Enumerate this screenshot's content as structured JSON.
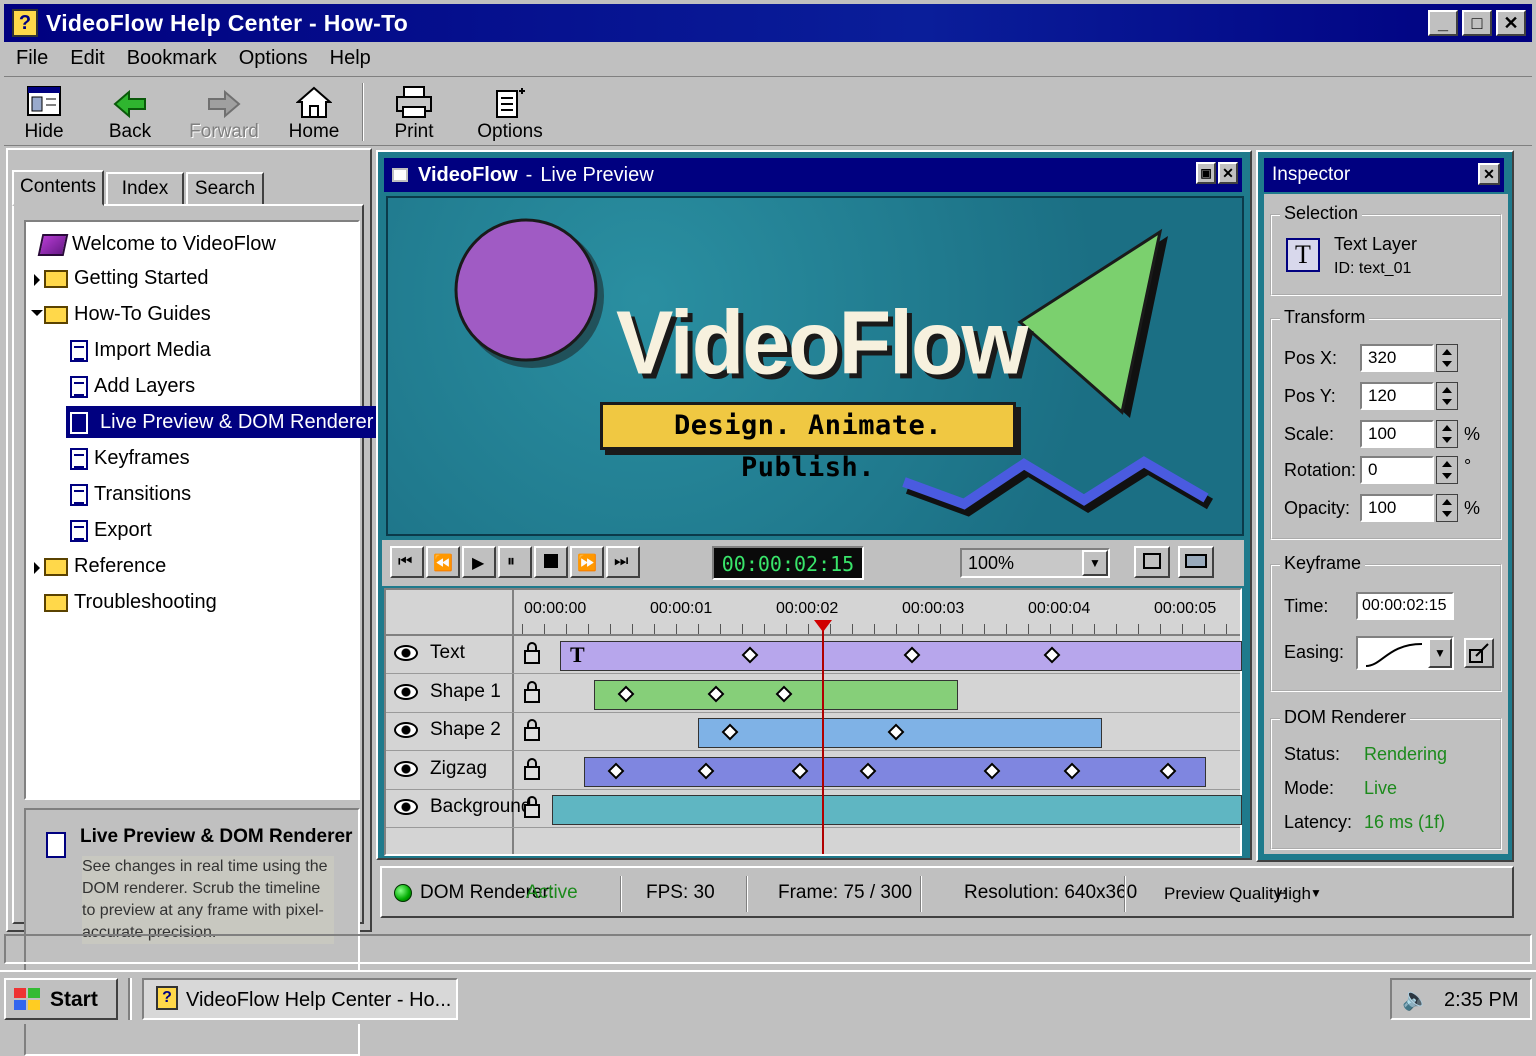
{
  "window": {
    "title": "VideoFlow Help Center - How-To"
  },
  "menu": [
    {
      "label": "File"
    },
    {
      "label": "Edit"
    },
    {
      "label": "Bookmark"
    },
    {
      "label": "Options"
    },
    {
      "label": "Help"
    }
  ],
  "toolbar": {
    "hide": "Hide",
    "back": "Back",
    "forward": "Forward",
    "home": "Home",
    "print": "Print",
    "options": "Options"
  },
  "tabs": {
    "contents": "Contents",
    "index": "Index",
    "search": "Search"
  },
  "tree": [
    {
      "label": "Welcome to VideoFlow",
      "type": "book"
    },
    {
      "label": "Getting Started",
      "type": "folder"
    },
    {
      "label": "How-To Guides",
      "type": "folder-open"
    },
    {
      "label": "Import Media",
      "type": "doc"
    },
    {
      "label": "Add Layers",
      "type": "doc"
    },
    {
      "label": "Live Preview & DOM Renderer",
      "type": "doc",
      "selected": true
    },
    {
      "label": "Keyframes",
      "type": "doc"
    },
    {
      "label": "Transitions",
      "type": "doc"
    },
    {
      "label": "Export",
      "type": "doc"
    },
    {
      "label": "Reference",
      "type": "folder"
    },
    {
      "label": "Troubleshooting",
      "type": "folder"
    }
  ],
  "topic": {
    "title": "Live Preview & DOM Renderer",
    "body": "See changes in real time using the DOM renderer. Scrub the timeline to preview at any frame with pixel-accurate precision."
  },
  "preview": {
    "title_app": "VideoFlow",
    "title_sep": "-",
    "title_view": "Live Preview",
    "stage_logo": "VideoFlow",
    "stage_tagline": "Design. Animate. Publish.",
    "timecode": "00:00:02:15",
    "zoom": "100%"
  },
  "timeline": {
    "ruler": [
      "00:00:00",
      "00:00:01",
      "00:00:02",
      "00:00:03",
      "00:00:04",
      "00:00:05"
    ],
    "playhead_seconds": 2.5,
    "tracks": [
      {
        "name": "Text",
        "color": "#b7a6ec"
      },
      {
        "name": "Shape 1",
        "color": "#86cf79"
      },
      {
        "name": "Shape 2",
        "color": "#7fb2e6"
      },
      {
        "name": "Zigzag",
        "color": "#7f86e0"
      },
      {
        "name": "Background",
        "color": "#5fb6c2"
      }
    ]
  },
  "inspector": {
    "title": "Inspector",
    "selection_group": "Selection",
    "layer_type": "Text Layer",
    "layer_id": "ID:  text_01",
    "transform_group": "Transform",
    "pos_x_label": "Pos X:",
    "pos_x": "320",
    "pos_y_label": "Pos Y:",
    "pos_y": "120",
    "scale_label": "Scale:",
    "scale": "100",
    "scale_unit": "%",
    "rotation_label": "Rotation:",
    "rotation": "0",
    "rotation_unit": "°",
    "opacity_label": "Opacity:",
    "opacity": "100",
    "opacity_unit": "%",
    "keyframe_group": "Keyframe",
    "time_label": "Time:",
    "time": "00:00:02:15",
    "easing_label": "Easing:",
    "dom_group": "DOM Renderer",
    "status_label": "Status:",
    "status": "Rendering",
    "mode_label": "Mode:",
    "mode": "Live",
    "latency_label": "Latency:",
    "latency": "16 ms (1f)"
  },
  "statusbar": {
    "dom_label": "DOM Renderer:",
    "dom_value": "Active",
    "fps": "FPS: 30",
    "frame": "Frame: 75 / 300",
    "resolution": "Resolution: 640x360",
    "quality_label": "Preview Quality:",
    "quality_value": "High"
  },
  "taskbar": {
    "start": "Start",
    "task": "VideoFlow Help Center - Ho...",
    "clock": "2:35 PM"
  }
}
